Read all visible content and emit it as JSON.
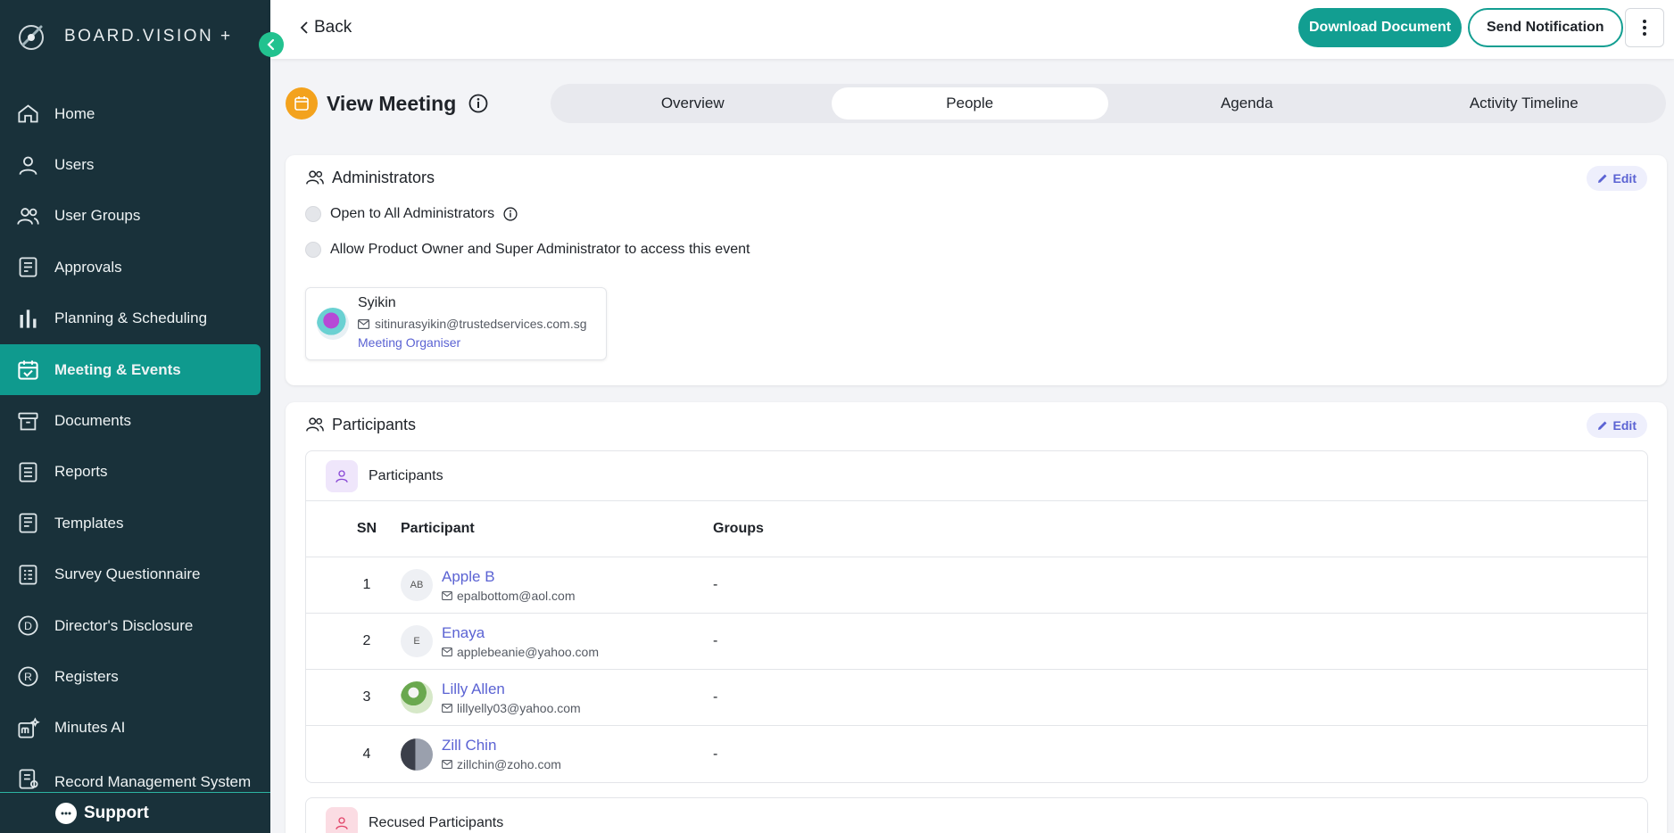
{
  "brand": {
    "name": "BOARD.VISION +"
  },
  "sidebar": {
    "items": [
      {
        "label": "Home",
        "icon": "home-icon"
      },
      {
        "label": "Users",
        "icon": "user-icon"
      },
      {
        "label": "User Groups",
        "icon": "users-icon"
      },
      {
        "label": "Approvals",
        "icon": "approval-icon"
      },
      {
        "label": "Planning & Scheduling",
        "icon": "bar-chart-icon"
      },
      {
        "label": "Meeting & Events",
        "icon": "calendar-check-icon",
        "active": true
      },
      {
        "label": "Documents",
        "icon": "archive-icon"
      },
      {
        "label": "Reports",
        "icon": "report-list-icon"
      },
      {
        "label": "Templates",
        "icon": "template-icon"
      },
      {
        "label": "Survey Questionnaire",
        "icon": "survey-icon"
      },
      {
        "label": "Director's Disclosure",
        "icon": "d-circle-icon"
      },
      {
        "label": "Registers",
        "icon": "r-circle-icon"
      },
      {
        "label": "Minutes AI",
        "icon": "minutes-ai-icon"
      },
      {
        "label": "Record Management System",
        "icon": "record-icon"
      }
    ],
    "support_label": "Support"
  },
  "topbar": {
    "back_label": "Back",
    "download_label": "Download Document",
    "notify_label": "Send Notification"
  },
  "page": {
    "title": "View Meeting",
    "tabs": [
      "Overview",
      "People",
      "Agenda",
      "Activity Timeline"
    ],
    "active_tab": "People"
  },
  "administrators": {
    "heading": "Administrators",
    "edit_label": "Edit",
    "option_open": "Open to All Administrators",
    "option_allow": "Allow Product Owner and Super Administrator to access this event",
    "organiser": {
      "name": "Syikin",
      "email": "sitinurasyikin@trustedservices.com.sg",
      "role": "Meeting Organiser"
    }
  },
  "participants": {
    "heading": "Participants",
    "edit_label": "Edit",
    "sub_heading": "Participants",
    "columns": [
      "SN",
      "Participant",
      "Groups"
    ],
    "rows": [
      {
        "sn": "1",
        "initials": "AB",
        "name": "Apple B",
        "email": "epalbottom@aol.com",
        "groups": "-"
      },
      {
        "sn": "2",
        "initials": "E",
        "name": "Enaya",
        "email": "applebeanie@yahoo.com",
        "groups": "-"
      },
      {
        "sn": "3",
        "initials": "",
        "name": "Lilly Allen",
        "email": "lillyelly03@yahoo.com",
        "groups": "-"
      },
      {
        "sn": "4",
        "initials": "",
        "name": "Zill Chin",
        "email": "zillchin@zoho.com",
        "groups": "-"
      }
    ],
    "recused_heading": "Recused Participants"
  },
  "colors": {
    "sidebar_bg": "#19313a",
    "accent": "#129e91",
    "active_nav": "#0f9a8e",
    "link": "#5b63d3",
    "badge_orange": "#f3a21d",
    "collapse_green": "#22c28f"
  }
}
